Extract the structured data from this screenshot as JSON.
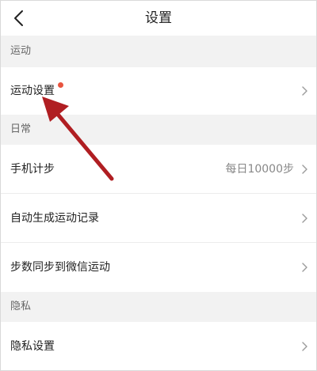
{
  "header": {
    "title": "设置",
    "back_icon": "chevron-left-icon"
  },
  "sections": {
    "sport": {
      "label": "运动"
    },
    "daily": {
      "label": "日常"
    },
    "privacy": {
      "label": "隐私"
    }
  },
  "rows": {
    "sport_settings": {
      "label": "运动设置",
      "has_red_dot": true,
      "badge_color": "#e8543f"
    },
    "step_counter": {
      "label": "手机计步",
      "value": "每日10000步"
    },
    "auto_records": {
      "label": "自动生成运动记录"
    },
    "sync_wechat": {
      "label": "步数同步到微信运动"
    },
    "privacy_settings": {
      "label": "隐私设置"
    }
  },
  "icons": {
    "row_arrow": "chevron-right-icon"
  },
  "colors": {
    "section_background": "#f2f2f2",
    "badge": "#e8543f",
    "annotation_arrow": "#b01e22"
  }
}
